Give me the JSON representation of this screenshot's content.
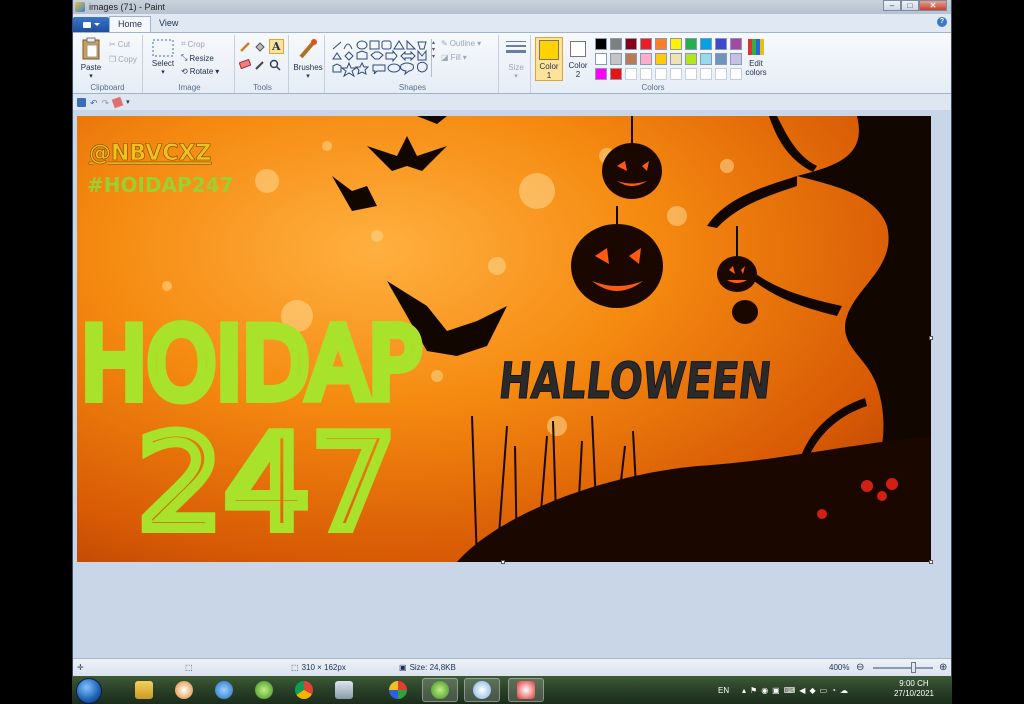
{
  "window": {
    "title": "images (71) - Paint"
  },
  "tabs": [
    {
      "label": "Home"
    },
    {
      "label": "View"
    }
  ],
  "ribbon": {
    "clipboard": {
      "label": "Clipboard",
      "paste": "Paste",
      "cut": "Cut",
      "copy": "Copy"
    },
    "image": {
      "label": "Image",
      "select": "Select",
      "crop": "Crop",
      "resize": "Resize",
      "rotate": "Rotate"
    },
    "tools": {
      "label": "Tools"
    },
    "brushes": {
      "label": "Brushes"
    },
    "shapes": {
      "label": "Shapes",
      "outline": "Outline",
      "fill": "Fill"
    },
    "size": {
      "label": "Size"
    },
    "colors": {
      "label": "Colors",
      "color1_label": "Color",
      "color1_num": "1",
      "color2_label": "Color",
      "color2_num": "2",
      "edit_label": "Edit",
      "edit_label2": "colors",
      "color1": "#ffd200",
      "color2": "#ffffff",
      "palette_row1": [
        "#000000",
        "#7f7f7f",
        "#880015",
        "#ed1c24",
        "#ff7f27",
        "#fff200",
        "#22b14c",
        "#00a2e8",
        "#3f48cc",
        "#a349a4"
      ],
      "palette_row2": [
        "#ffffff",
        "#c3c3c3",
        "#b97a57",
        "#ffaec9",
        "#ffc90e",
        "#efe4b0",
        "#b5e61d",
        "#99d9ea",
        "#7092be",
        "#c8bfe7"
      ],
      "palette_row3": [
        "#ff00ff",
        "#ee1111"
      ]
    }
  },
  "artwork": {
    "watermark1": "@NBVCXZ",
    "watermark2": "#HOIDAP247",
    "big_line1": "HOIDAP",
    "big_line2": "247",
    "halloween": "HALLOWEEN"
  },
  "statusbar": {
    "dimensions": "310 × 162px",
    "size": "Size: 24,8KB",
    "zoom": "400%",
    "zoom_level": 0.66
  },
  "taskbar": {
    "language": "EN",
    "time": "9:00 CH",
    "date": "27/10/2021"
  }
}
